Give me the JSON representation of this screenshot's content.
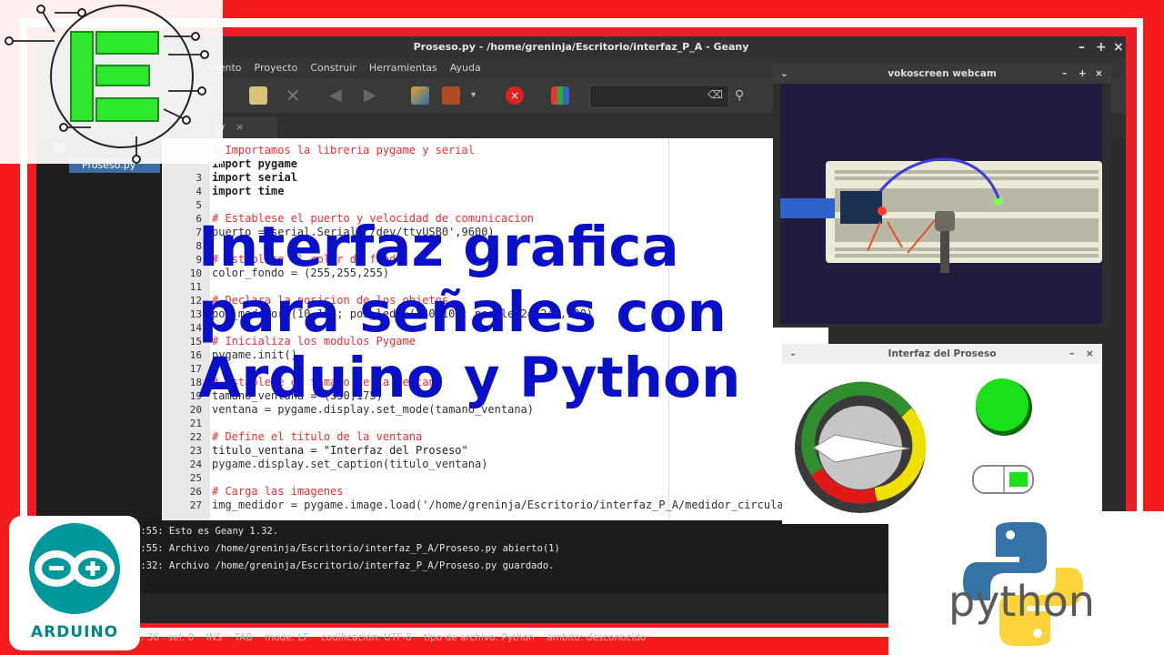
{
  "window": {
    "title": "Proseso.py - /home/greninja/Escritorio/interfaz_P_A - Geany",
    "controls": [
      "–",
      "+",
      "×"
    ]
  },
  "menubar": [
    "mento",
    "Proyecto",
    "Construir",
    "Herramientas",
    "Ayuda"
  ],
  "tabs": [
    {
      "label": "y",
      "close": "×"
    }
  ],
  "sidebar": {
    "file": "Proseso.py"
  },
  "code": [
    {
      "n": "",
      "text": "# Importamos la libreria pygame y serial",
      "kind": "comment"
    },
    {
      "n": "",
      "text": "import pygame",
      "kind": "import"
    },
    {
      "n": "3",
      "text": "import serial",
      "kind": "import"
    },
    {
      "n": "4",
      "text": "import time",
      "kind": "import"
    },
    {
      "n": "5",
      "text": "",
      "kind": "plain"
    },
    {
      "n": "6",
      "text": "# Establese el puerto y velocidad de comunicacion",
      "kind": "comment"
    },
    {
      "n": "7",
      "text": "puerto = serial.Serial('/dev/ttyUSB0',9600)",
      "kind": "plain"
    },
    {
      "n": "8",
      "text": "",
      "kind": "plain"
    },
    {
      "n": "9",
      "text": "# Establece el color de fondo",
      "kind": "comment"
    },
    {
      "n": "10",
      "text": "color_fondo = (255,255,255)",
      "kind": "plain"
    },
    {
      "n": "11",
      "text": "",
      "kind": "plain"
    },
    {
      "n": "12",
      "text": "# Declara la posicion de los objetos",
      "kind": "comment"
    },
    {
      "n": "13",
      "text": "pos_medidor=(10,10); pos_led1=(240,10); pos_led2=(240,120)",
      "kind": "plain"
    },
    {
      "n": "14",
      "text": "",
      "kind": "plain"
    },
    {
      "n": "15",
      "text": "# Inicializa los modulos Pygame",
      "kind": "comment"
    },
    {
      "n": "16",
      "text": "pygame.init()",
      "kind": "plain"
    },
    {
      "n": "17",
      "text": "",
      "kind": "plain"
    },
    {
      "n": "18",
      "text": "# Establece el tamano de la ventana",
      "kind": "comment"
    },
    {
      "n": "19",
      "text": "tamano_ventana = (350,175)",
      "kind": "plain"
    },
    {
      "n": "20",
      "text": "ventana = pygame.display.set_mode(tamano_ventana)",
      "kind": "plain"
    },
    {
      "n": "21",
      "text": "",
      "kind": "plain"
    },
    {
      "n": "22",
      "text": "# Define el titulo de la ventana",
      "kind": "comment"
    },
    {
      "n": "23",
      "text": "titulo_ventana = \"Interfaz del Proseso\"",
      "kind": "string"
    },
    {
      "n": "24",
      "text": "pygame.display.set_caption(titulo_ventana)",
      "kind": "plain"
    },
    {
      "n": "25",
      "text": "",
      "kind": "plain"
    },
    {
      "n": "26",
      "text": "# Carga las imagenes",
      "kind": "comment"
    },
    {
      "n": "27",
      "text": "img_medidor = pygame.image.load('/home/greninja/Escritorio/interfaz_P_A/medidor_circular.png')",
      "kind": "plain"
    }
  ],
  "messages": [
    "4:55: Esto es Geany 1.32.",
    "4:55: Archivo /home/greninja/Escritorio/interfaz_P_A/Proseso.py abierto(1)",
    "8:32: Archivo /home/greninja/Escritorio/interfaz_P_A/Proseso.py guardado."
  ],
  "statusbar": ": 36   sel: 0    INS    TAB    mode: LF    codificación: UTF-8    tipo de archivo: Python    ámbito: desconocido",
  "webcam": {
    "title": "vokoscreen webcam",
    "controls": [
      "⌄",
      "–",
      "+",
      "×"
    ]
  },
  "interfaz": {
    "title": "Interfaz del Proseso",
    "controls": [
      "–",
      "×"
    ]
  },
  "headline": [
    "Interfaz grafica",
    "para señales con",
    "Arduino y Python"
  ],
  "arduino": {
    "label": "ARDUINO"
  },
  "python": {
    "label": "python"
  },
  "colors": {
    "frame": "#f51b1b",
    "headline": "#0a10c8",
    "arduino_teal": "#00979c",
    "python_blue": "#3572a5",
    "python_yellow": "#ffd43b",
    "logo_green": "#2ee82e"
  }
}
